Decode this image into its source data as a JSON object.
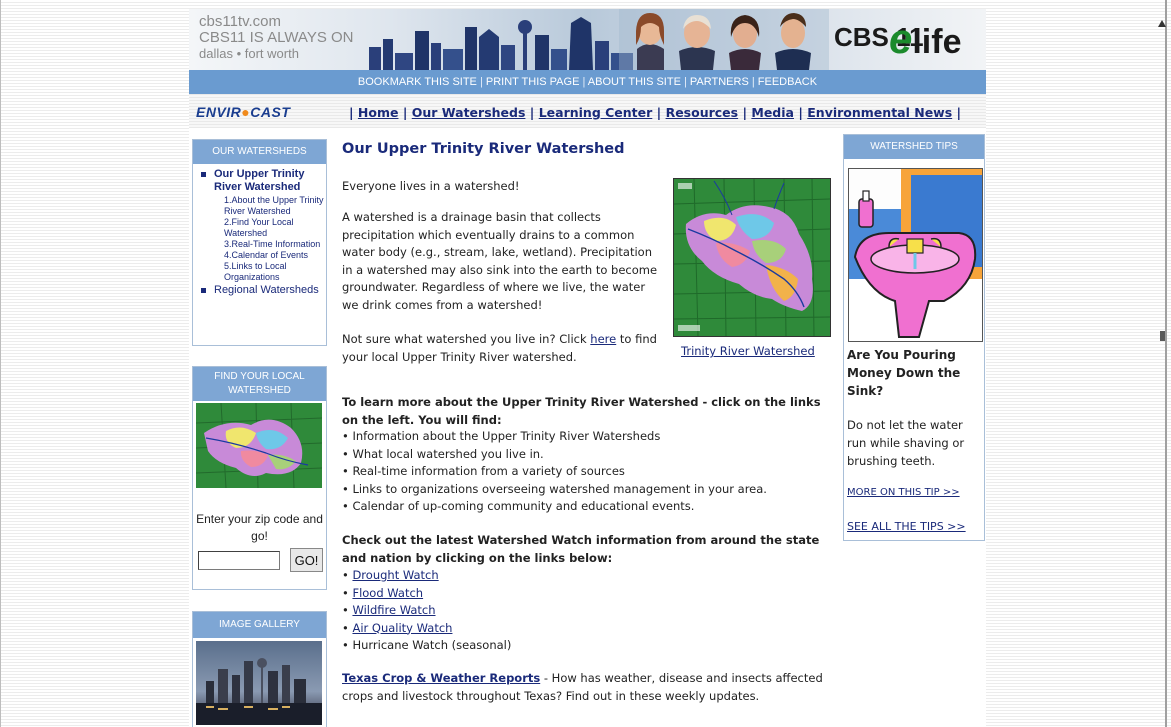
{
  "header": {
    "site": "cbs11tv.com",
    "tagline": "CBS11 IS ALWAYS ON",
    "region": "dallas • fort worth",
    "logo_cbs": "CBS 11",
    "logo_elife": "life",
    "logo_elife_e": "e"
  },
  "topbar": {
    "links": [
      "BOOKMARK THIS SITE",
      "PRINT THIS PAGE",
      "ABOUT THIS SITE",
      "PARTNERS",
      "FEEDBACK"
    ]
  },
  "nav": {
    "logo_prefix": "ENVIR",
    "logo_o": "●",
    "logo_suffix": "CAST",
    "links": [
      "Home",
      "Our Watersheds",
      "Learning Center",
      "Resources",
      "Media",
      "Environmental News"
    ]
  },
  "sidebar": {
    "watersheds": {
      "title": "OUR WATERSHEDS",
      "active": "Our Upper Trinity River Watershed",
      "subitems": [
        "1.About the Upper Trinity River Watershed",
        "2.Find Your Local Watershed",
        "3.Real-Time Information",
        "4.Calendar of Events",
        "5.Links to Local Organizations"
      ],
      "other": "Regional Watersheds"
    },
    "find": {
      "title": "FIND YOUR LOCAL WATERSHED",
      "zip_label": "Enter your zip code and go!",
      "zip_value": "",
      "go_label": "GO!"
    },
    "gallery": {
      "title": "IMAGE GALLERY"
    }
  },
  "main": {
    "title": "Our Upper Trinity River Watershed",
    "intro": "Everyone lives in a watershed!",
    "definition": "A watershed is a drainage basin that collects precipitation which eventually drains to a common water body (e.g., stream, lake, wetland). Precipitation in a watershed may also sink into the earth to become groundwater. Regardless of where we live, the water we drink comes from a watershed!",
    "not_sure_prefix": "Not sure what watershed you live in? Click ",
    "not_sure_link": "here",
    "not_sure_suffix": " to find your local Upper Trinity River watershed.",
    "map_caption": "Trinity River Watershed",
    "learn_more": "To learn more about the Upper Trinity River Watershed - click on the links on the left. You will find:",
    "find_items": [
      "Information about the Upper Trinity River Watersheds",
      "What local watershed you live in.",
      "Real-time information from a variety of sources",
      "Links to organizations overseeing watershed management in your area.",
      "Calendar of up-coming community and educational events."
    ],
    "check_out": "Check out the latest Watershed Watch information from around the state and nation by clicking on the links below:",
    "watch_links": [
      "Drought Watch",
      "Flood Watch",
      "Wildfire Watch",
      "Air Quality Watch"
    ],
    "watch_static": "Hurricane Watch (seasonal)",
    "crop_link": "Texas Crop & Weather Reports",
    "crop_text": " - How has weather, disease and insects affected crops and livestock throughout Texas? Find out in these weekly updates."
  },
  "tips": {
    "title": "WATERSHED TIPS",
    "tip_title": "Are You Pouring Money Down the Sink?",
    "tip_body": "Do not let the water run while shaving or brushing teeth.",
    "more_link": "MORE ON THIS TIP >>",
    "all_link": "SEE ALL THE TIPS >>"
  },
  "colors": {
    "nav_blue": "#6a9bd0",
    "link_navy": "#1a2a7a",
    "side_head": "#7ea6d4",
    "envirocast_orange": "#f08a1c",
    "elife_green": "#1b8a2c"
  }
}
